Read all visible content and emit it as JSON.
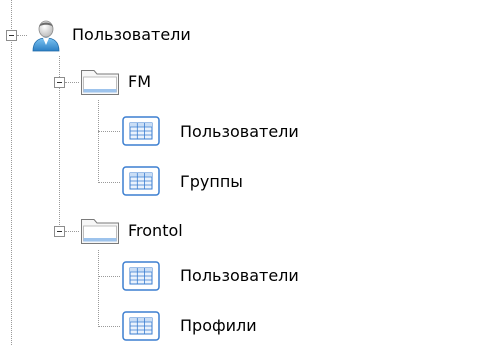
{
  "tree": {
    "root": {
      "label": "Пользователи",
      "icon": "user-icon",
      "expanded": true,
      "children": [
        {
          "label": "FM",
          "icon": "folder-icon",
          "expanded": true,
          "children": [
            {
              "label": "Пользователи",
              "icon": "table-icon"
            },
            {
              "label": "Группы",
              "icon": "table-icon"
            }
          ]
        },
        {
          "label": "Frontol",
          "icon": "folder-icon",
          "expanded": true,
          "children": [
            {
              "label": "Пользователи",
              "icon": "table-icon"
            },
            {
              "label": "Профили",
              "icon": "table-icon"
            }
          ]
        }
      ]
    }
  },
  "colors": {
    "connector": "#9a9a9a",
    "table_icon_border": "#3b7ed0",
    "table_icon_header": "#c9ddf5",
    "folder_fill": "#f5f5f5"
  }
}
